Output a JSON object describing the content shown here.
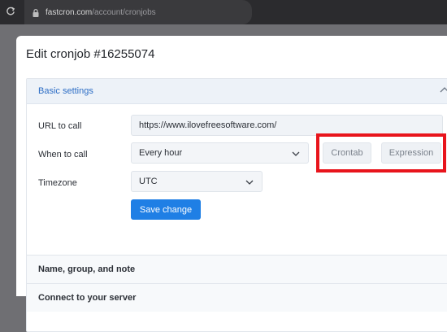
{
  "browser": {
    "url_host": "fastcron.com",
    "url_path": "/account/cronjobs"
  },
  "modal": {
    "title": "Edit cronjob #16255074"
  },
  "basic_settings": {
    "header": "Basic settings",
    "url_label": "URL to call",
    "url_value": "https://www.ilovefreesoftware.com/",
    "when_label": "When to call",
    "when_value": "Every hour",
    "crontab_label": "Crontab",
    "expression_label": "Expression",
    "timezone_label": "Timezone",
    "timezone_value": "UTC",
    "save_label": "Save change"
  },
  "sections": {
    "name_group_note": "Name, group, and note",
    "connect_server": "Connect to your server"
  },
  "colors": {
    "accent": "#1f7fe5",
    "highlight": "#e8141c",
    "section_header_bg": "#edf2f8"
  },
  "icons": [
    "reload-icon",
    "lock-icon",
    "chevron-up-icon",
    "chevron-down-icon"
  ]
}
